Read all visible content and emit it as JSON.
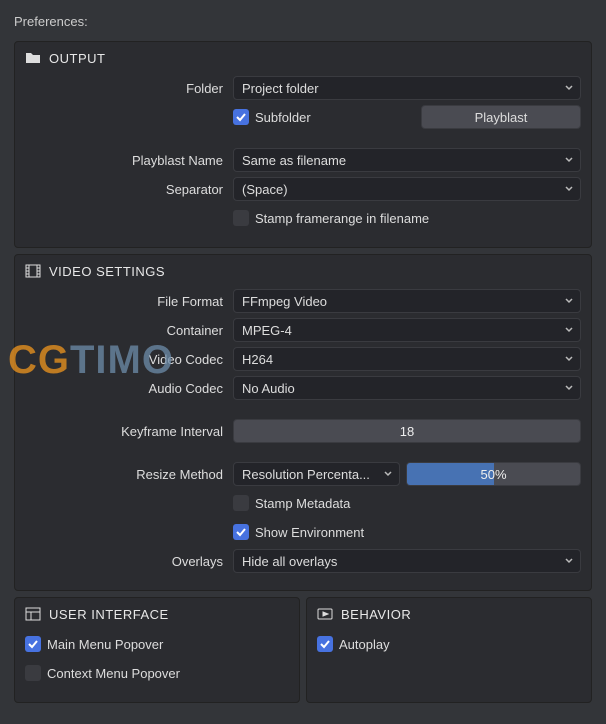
{
  "preferencesLabel": "Preferences:",
  "output": {
    "title": "OUTPUT",
    "folderLabel": "Folder",
    "folderValue": "Project folder",
    "subfolderChecked": true,
    "subfolderLabel": "Subfolder",
    "subfolderValue": "Playblast",
    "playblastNameLabel": "Playblast Name",
    "playblastNameValue": "Same as filename",
    "separatorLabel": "Separator",
    "separatorValue": "(Space)",
    "stampFramerangeChecked": false,
    "stampFramerangeLabel": "Stamp framerange in filename"
  },
  "video": {
    "title": "VIDEO SETTINGS",
    "fileFormatLabel": "File Format",
    "fileFormatValue": "FFmpeg Video",
    "containerLabel": "Container",
    "containerValue": "MPEG-4",
    "videoCodecLabel": "Video Codec",
    "videoCodecValue": "H264",
    "audioCodecLabel": "Audio Codec",
    "audioCodecValue": "No Audio",
    "keyframeIntervalLabel": "Keyframe Interval",
    "keyframeIntervalValue": "18",
    "resizeMethodLabel": "Resize Method",
    "resizeMethodValue": "Resolution Percenta...",
    "resizePercentValue": "50%",
    "stampMetadataChecked": false,
    "stampMetadataLabel": "Stamp Metadata",
    "showEnvChecked": true,
    "showEnvLabel": "Show Environment",
    "overlaysLabel": "Overlays",
    "overlaysValue": "Hide all overlays"
  },
  "ui": {
    "title": "USER INTERFACE",
    "mainMenuChecked": true,
    "mainMenuLabel": "Main Menu Popover",
    "contextMenuChecked": false,
    "contextMenuLabel": "Context Menu Popover"
  },
  "behavior": {
    "title": "BEHAVIOR",
    "autoplayChecked": true,
    "autoplayLabel": "Autoplay"
  },
  "watermark": {
    "a": "CG",
    "b": "TIMO"
  }
}
